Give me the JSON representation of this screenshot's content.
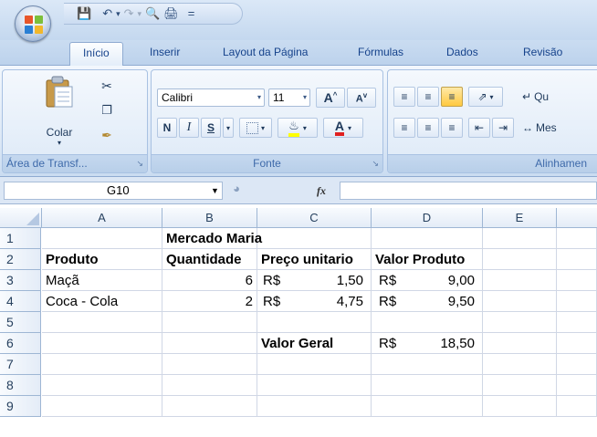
{
  "qat": {
    "title_marker": "="
  },
  "tabs": [
    {
      "label": "Início",
      "active": true
    },
    {
      "label": "Inserir"
    },
    {
      "label": "Layout da Página"
    },
    {
      "label": "Fórmulas"
    },
    {
      "label": "Dados"
    },
    {
      "label": "Revisão"
    }
  ],
  "ribbon": {
    "clipboard": {
      "paste_label": "Colar",
      "group_label": "Área de Transf..."
    },
    "font": {
      "font_name": "Calibri",
      "font_size": "11",
      "group_label": "Fonte",
      "bold": "N",
      "italic": "I",
      "underline": "S"
    },
    "alignment": {
      "group_label": "Alinhamen",
      "wrap_label": "Qu",
      "merge_label": "Mes"
    }
  },
  "formula_bar": {
    "name_box": "G10",
    "fx": "fx",
    "formula": ""
  },
  "columns": [
    "A",
    "B",
    "C",
    "D",
    "E"
  ],
  "rows": [
    "1",
    "2",
    "3",
    "4",
    "5",
    "6",
    "7",
    "8",
    "9"
  ],
  "sheet": {
    "title": "Mercado Maria",
    "headers": {
      "produto": "Produto",
      "quantidade": "Quantidade",
      "preco": "Preço unitario",
      "valor": "Valor Produto"
    },
    "items": [
      {
        "produto": "Maçã",
        "quantidade": "6",
        "preco_cur": "R$",
        "preco": "1,50",
        "valor_cur": "R$",
        "valor": "9,00"
      },
      {
        "produto": "Coca - Cola",
        "quantidade": "2",
        "preco_cur": "R$",
        "preco": "4,75",
        "valor_cur": "R$",
        "valor": "9,50"
      }
    ],
    "total": {
      "label": "Valor Geral",
      "cur": "R$",
      "value": "18,50"
    }
  },
  "colors": {
    "accent": "#15428b",
    "ribbon": "#dbe7f6",
    "grid_line": "#d0d7e5"
  }
}
